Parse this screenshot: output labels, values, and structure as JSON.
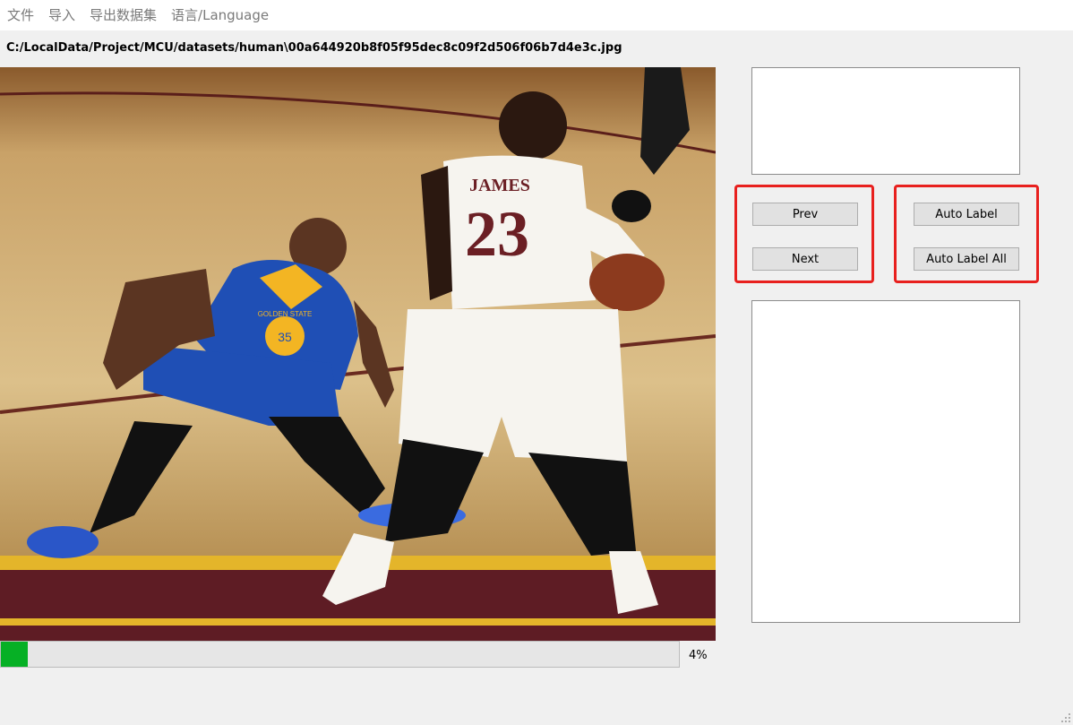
{
  "menu": {
    "items": [
      "文件",
      "导入",
      "导出数据集",
      "语言/Language"
    ]
  },
  "file_path": "C:/LocalData/Project/MCU/datasets/human\\00a644920b8f05f95dec8c09f2d506f06b7d4e3c.jpg",
  "image": {
    "description_icon": "photo-image",
    "jersey_left_number": "35",
    "jersey_left_text": "GOLDEN STATE",
    "jersey_right_name": "JAMES",
    "jersey_right_number": "23"
  },
  "buttons": {
    "prev": "Prev",
    "next": "Next",
    "auto_label": "Auto Label",
    "auto_label_all": "Auto Label All"
  },
  "progress": {
    "percent_label": "4%",
    "value": 0.04
  },
  "colors": {
    "progress_fill": "#06b025",
    "highlight": "#e8201e"
  }
}
